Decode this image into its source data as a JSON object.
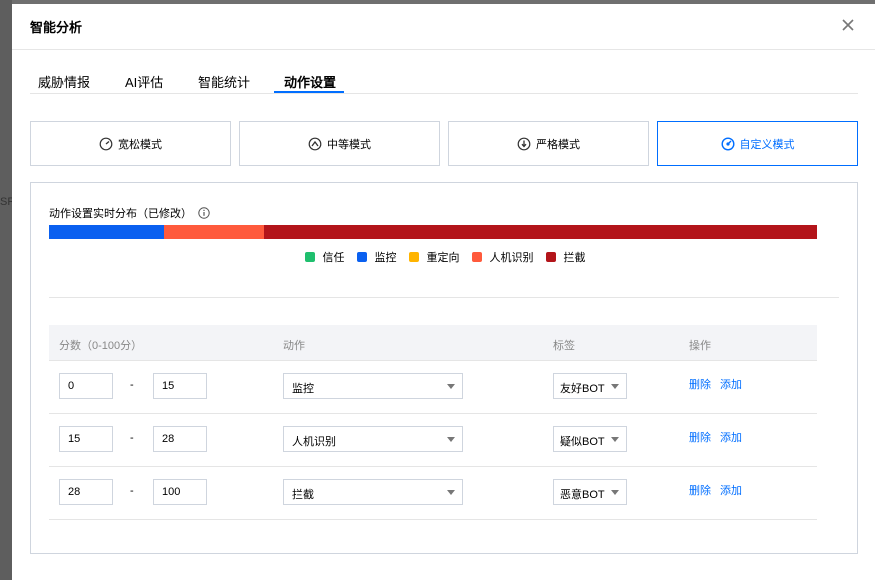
{
  "backdrop": {
    "fragment": "SR"
  },
  "modal": {
    "title": "智能分析"
  },
  "tabs": [
    {
      "label": "威胁情报"
    },
    {
      "label": "AI评估"
    },
    {
      "label": "智能统计"
    },
    {
      "label": "动作设置"
    }
  ],
  "active_tab": "动作设置",
  "modes": [
    {
      "label": "宽松模式",
      "icon": "gauge-low-icon"
    },
    {
      "label": "中等模式",
      "icon": "gauge-mid-icon"
    },
    {
      "label": "严格模式",
      "icon": "gauge-high-icon"
    },
    {
      "label": "自定义模式",
      "icon": "gauge-custom-icon"
    }
  ],
  "active_mode": "自定义模式",
  "distribution": {
    "title": "动作设置实时分布（已修改）",
    "segments": [
      {
        "label": "监控",
        "start": 0,
        "end": 15,
        "color": "#0a60f0"
      },
      {
        "label": "人机识别",
        "start": 15,
        "end": 28,
        "color": "#ff5a3c"
      },
      {
        "label": "拦截",
        "start": 28,
        "end": 100,
        "color": "#b3141a"
      }
    ],
    "legend": [
      {
        "label": "信任",
        "color": "#1fbf6e"
      },
      {
        "label": "监控",
        "color": "#0a60f0"
      },
      {
        "label": "重定向",
        "color": "#ffb400"
      },
      {
        "label": "人机识别",
        "color": "#ff5a3c"
      },
      {
        "label": "拦截",
        "color": "#b3141a"
      }
    ]
  },
  "table": {
    "headers": {
      "score": "分数（0-100分）",
      "action": "动作",
      "tag": "标签",
      "ops": "操作"
    },
    "separator": "-",
    "delete_label": "删除",
    "add_label": "添加",
    "rows": [
      {
        "from": "0",
        "to": "15",
        "action": "监控",
        "tag": "友好BOT"
      },
      {
        "from": "15",
        "to": "28",
        "action": "人机识别",
        "tag": "疑似BOT"
      },
      {
        "from": "28",
        "to": "100",
        "action": "拦截",
        "tag": "恶意BOT"
      }
    ]
  },
  "colors": {
    "accent": "#006eff"
  }
}
